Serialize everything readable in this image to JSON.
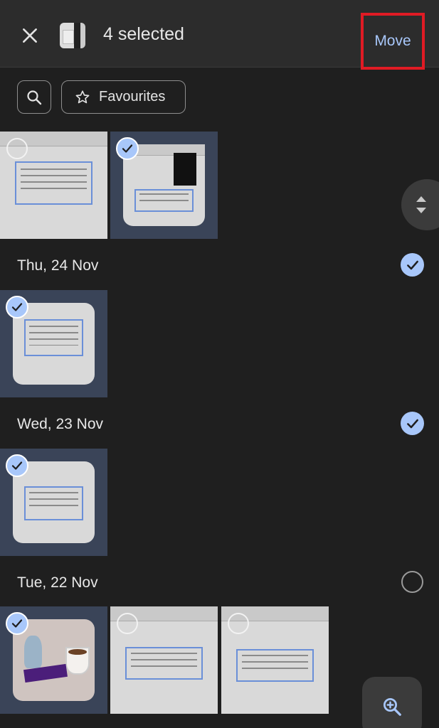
{
  "header": {
    "selected_label": "4 selected",
    "move_label": "Move"
  },
  "filters": {
    "favourites_label": "Favourites"
  },
  "groups": [
    {
      "date": "Thu, 24 Nov",
      "selected": true
    },
    {
      "date": "Wed, 23 Nov",
      "selected": true
    },
    {
      "date": "Tue, 22 Nov",
      "selected": false
    }
  ],
  "icons": {
    "close": "close-icon",
    "search": "search-icon",
    "star": "star-icon",
    "check": "check-icon",
    "scroll": "scroll-handle-icon",
    "zoom": "zoom-in-icon"
  },
  "colors": {
    "accent": "#a8c7fa",
    "highlight_box": "#e01b24"
  }
}
